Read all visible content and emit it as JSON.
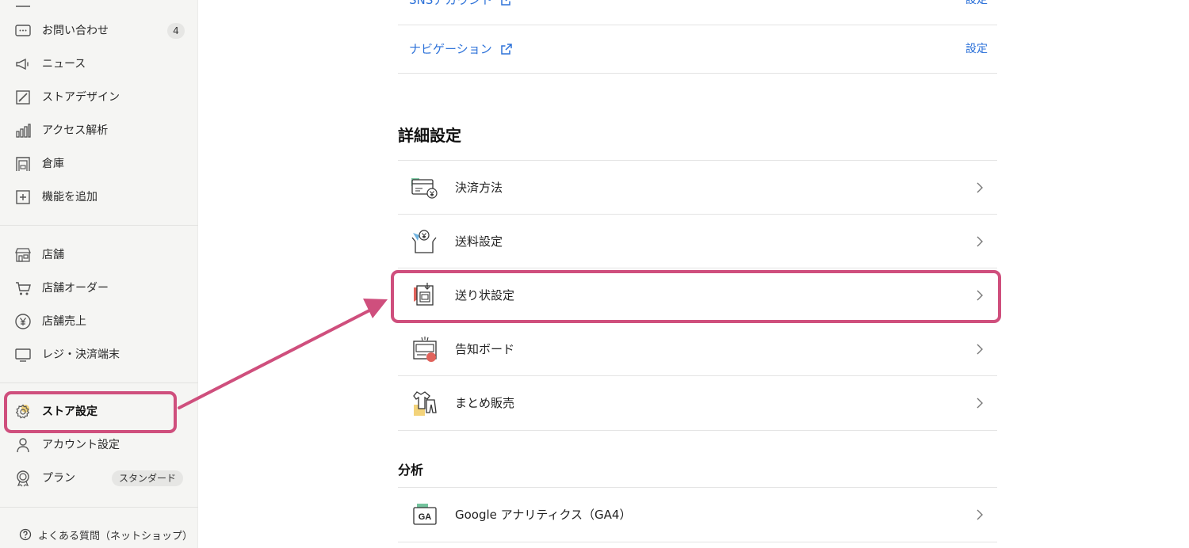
{
  "sidebar": {
    "items_top": [
      {
        "label": "お問い合わせ",
        "badge": "4",
        "icon": "chat-bubble-icon"
      },
      {
        "label": "ニュース",
        "icon": "megaphone-icon"
      },
      {
        "label": "ストアデザイン",
        "icon": "pencil-canvas-icon"
      },
      {
        "label": "アクセス解析",
        "icon": "bar-chart-icon"
      },
      {
        "label": "倉庫",
        "icon": "warehouse-icon"
      },
      {
        "label": "機能を追加",
        "icon": "plus-box-icon"
      }
    ],
    "items_store": [
      {
        "label": "店舗",
        "icon": "storefront-icon"
      },
      {
        "label": "店舗オーダー",
        "icon": "cart-icon"
      },
      {
        "label": "店舗売上",
        "icon": "yen-circle-icon"
      },
      {
        "label": "レジ・決済端末",
        "icon": "monitor-icon"
      }
    ],
    "items_settings": [
      {
        "label": "ストア設定",
        "icon": "gear-icon",
        "active": true
      },
      {
        "label": "アカウント設定",
        "icon": "person-icon"
      },
      {
        "label": "プラン",
        "badge": "スタンダード",
        "icon": "award-icon"
      }
    ],
    "faq_label": "よくある質問（ネットショップ）"
  },
  "main": {
    "top_links": [
      {
        "label": "SNSアカウント",
        "action": "設定"
      },
      {
        "label": "ナビゲーション",
        "action": "設定"
      }
    ],
    "advanced_title": "詳細設定",
    "advanced_items": [
      {
        "label": "決済方法",
        "icon": "payment-card-icon"
      },
      {
        "label": "送料設定",
        "icon": "shipping-box-icon"
      },
      {
        "label": "送り状設定",
        "icon": "invoice-label-icon",
        "highlighted": true
      },
      {
        "label": "告知ボード",
        "icon": "notice-board-icon"
      },
      {
        "label": "まとめ販売",
        "icon": "bundle-clothes-icon"
      }
    ],
    "analytics_title": "分析",
    "analytics_items": [
      {
        "label": "Google アナリティクス（GA4）",
        "icon": "ga4-icon"
      }
    ]
  },
  "colors": {
    "link": "#2d72d9",
    "highlight": "#cf4f7d",
    "sidebar_bg": "#f5f5f3"
  }
}
